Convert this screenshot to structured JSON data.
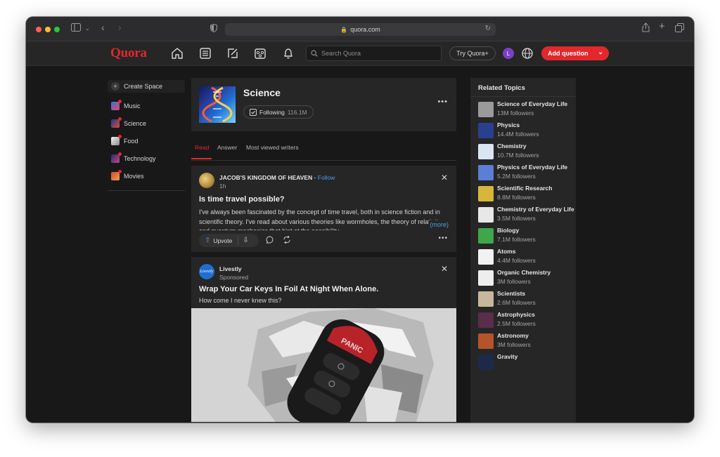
{
  "browser": {
    "url": "quora.com"
  },
  "header": {
    "logo": "Quora",
    "search_placeholder": "Search Quora",
    "try_label": "Try Quora+",
    "avatar_initial": "L",
    "add_question_label": "Add question"
  },
  "sidebar": {
    "create_space": "Create Space",
    "items": [
      {
        "label": "Music"
      },
      {
        "label": "Science"
      },
      {
        "label": "Food"
      },
      {
        "label": "Technology"
      },
      {
        "label": "Movies"
      }
    ]
  },
  "topic": {
    "title": "Science",
    "following_label": "Following",
    "following_count": "116.1M",
    "tabs": [
      {
        "label": "Read"
      },
      {
        "label": "Answer"
      },
      {
        "label": "Most viewed writers"
      }
    ]
  },
  "feed": {
    "post": {
      "author": "JACOB'S KINGDOM OF HEAVEN",
      "follow_label": "Follow",
      "time": "1h",
      "question": "Is time travel possible?",
      "body": "I've always been fascinated by the concept of time travel, both in science fiction and in scientific theory. I've read about various theories like wormholes, the theory of relativity, and quantum mechanics that hint at the possibility",
      "more_label": "(more)",
      "upvote_label": "Upvote"
    },
    "ad": {
      "advertiser": "Livestly",
      "sponsored_label": "Sponsored",
      "headline": "Wrap Your Car Keys In Foil At Night When Alone.",
      "subline": "How come I never knew this?",
      "key_button_text": "PANIC"
    }
  },
  "related": {
    "title": "Related Topics",
    "items": [
      {
        "name": "Science of Everyday Life",
        "followers": "13M followers",
        "color": "#9a9a9a"
      },
      {
        "name": "Physics",
        "followers": "14.4M followers",
        "color": "#2a3f8f"
      },
      {
        "name": "Chemistry",
        "followers": "10.7M followers",
        "color": "#d9e6f2"
      },
      {
        "name": "Physics of Everyday Life",
        "followers": "5.2M followers",
        "color": "#5a7fd6"
      },
      {
        "name": "Scientific Research",
        "followers": "8.8M followers",
        "color": "#d6b73a"
      },
      {
        "name": "Chemistry of Everyday Life",
        "followers": "3.5M followers",
        "color": "#e8e8e8"
      },
      {
        "name": "Biology",
        "followers": "7.1M followers",
        "color": "#3fa64a"
      },
      {
        "name": "Atoms",
        "followers": "4.4M followers",
        "color": "#f2f2f2"
      },
      {
        "name": "Organic Chemistry",
        "followers": "3M followers",
        "color": "#eeeeee"
      },
      {
        "name": "Scientists",
        "followers": "2.6M followers",
        "color": "#c8b79a"
      },
      {
        "name": "Astrophysics",
        "followers": "2.5M followers",
        "color": "#5a2d4a"
      },
      {
        "name": "Astronomy",
        "followers": "3M followers",
        "color": "#b5542a"
      },
      {
        "name": "Gravity",
        "followers": "",
        "color": "#1c2a4a"
      }
    ]
  }
}
